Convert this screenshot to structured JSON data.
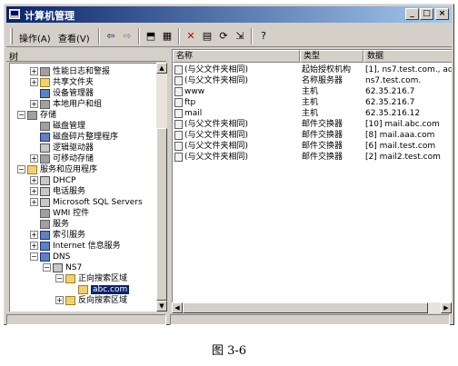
{
  "window": {
    "title": "计算机管理",
    "controls": {
      "minimize": "_",
      "maximize": "□",
      "close": "×"
    }
  },
  "menu": {
    "action": "操作(A)",
    "view": "查看(V)"
  },
  "tree": {
    "header": "树",
    "items": [
      {
        "label": "性能日志和警报",
        "icon": "performance-icon"
      },
      {
        "label": "共享文件夹",
        "icon": "shared-folder-icon"
      },
      {
        "label": "设备管理器",
        "icon": "device-manager-icon"
      },
      {
        "label": "本地用户和组",
        "icon": "users-icon"
      },
      {
        "label": "存储",
        "icon": "storage-icon"
      },
      {
        "label": "磁盘管理",
        "icon": "disk-icon"
      },
      {
        "label": "磁盘碎片整理程序",
        "icon": "defrag-icon"
      },
      {
        "label": "逻辑驱动器",
        "icon": "drive-icon"
      },
      {
        "label": "可移动存储",
        "icon": "removable-storage-icon"
      },
      {
        "label": "服务和应用程序",
        "icon": "services-apps-icon"
      },
      {
        "label": "DHCP",
        "icon": "dhcp-icon"
      },
      {
        "label": "电话服务",
        "icon": "telephony-icon"
      },
      {
        "label": "Microsoft SQL Servers",
        "icon": "sql-icon"
      },
      {
        "label": "WMI 控件",
        "icon": "wmi-icon"
      },
      {
        "label": "服务",
        "icon": "services-icon"
      },
      {
        "label": "索引服务",
        "icon": "indexing-icon"
      },
      {
        "label": "Internet 信息服务",
        "icon": "iis-icon"
      },
      {
        "label": "DNS",
        "icon": "dns-icon"
      },
      {
        "label": "NS7",
        "icon": "server-icon"
      },
      {
        "label": "正向搜索区域",
        "icon": "folder-icon"
      },
      {
        "label": "abc.com",
        "icon": "zone-icon"
      },
      {
        "label": "反向搜索区域",
        "icon": "folder-icon"
      }
    ]
  },
  "list": {
    "columns": [
      "名称",
      "类型",
      "数据"
    ],
    "rows": [
      [
        "(与父文件夹相同)",
        "起始授权机构",
        "[1], ns7.test.com., admin."
      ],
      [
        "(与父文件夹相同)",
        "名称服务器",
        "ns7.test.com."
      ],
      [
        "www",
        "主机",
        "62.35.216.7"
      ],
      [
        "ftp",
        "主机",
        "62.35.216.7"
      ],
      [
        "mail",
        "主机",
        "62.35.216.12"
      ],
      [
        "(与父文件夹相同)",
        "邮件交换器",
        "[10] mail.abc.com"
      ],
      [
        "(与父文件夹相同)",
        "邮件交换器",
        "[8] mail.aaa.com"
      ],
      [
        "(与父文件夹相同)",
        "邮件交换器",
        "[6] mail.test.com"
      ],
      [
        "(与父文件夹相同)",
        "邮件交换器",
        "[2] mail2.test.com"
      ]
    ]
  },
  "caption": "图 3-6"
}
